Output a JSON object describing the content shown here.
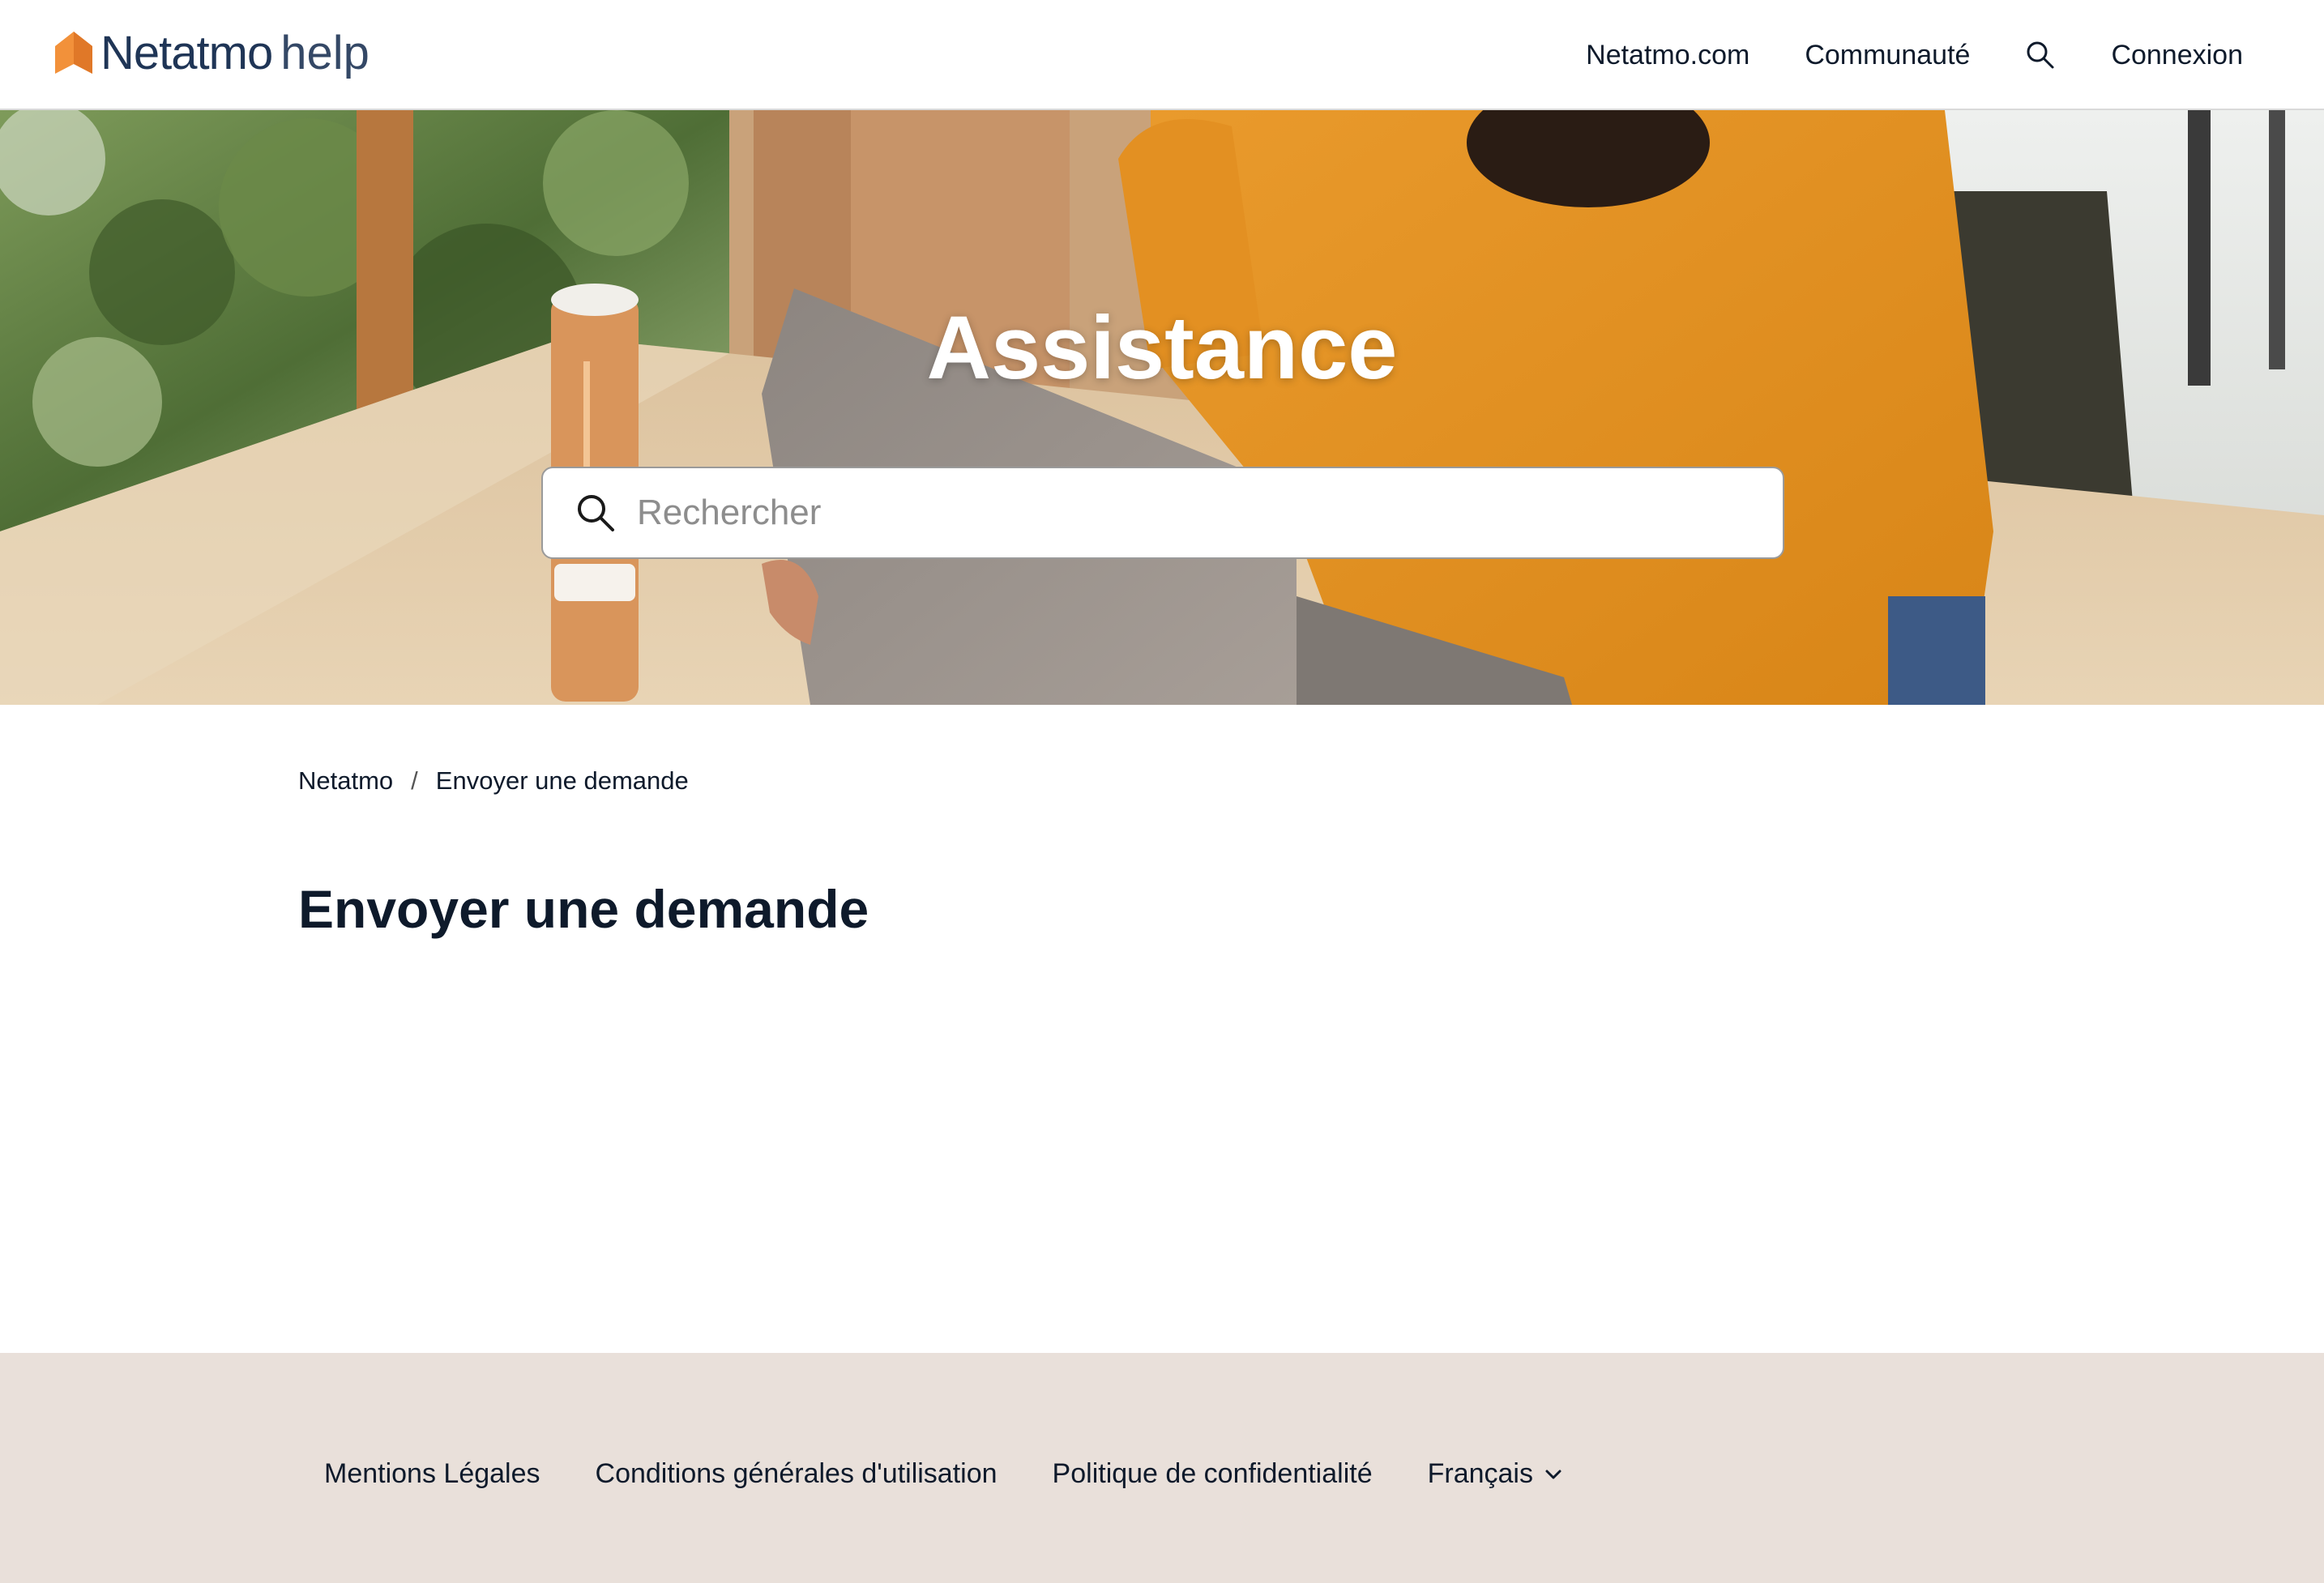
{
  "header": {
    "logo_brand": "Netatmo",
    "logo_suffix": "help",
    "nav": [
      {
        "label": "Netatmo.com"
      },
      {
        "label": "Communauté"
      },
      {
        "label": "Connexion"
      }
    ],
    "search_icon": "search-icon"
  },
  "hero": {
    "title": "Assistance",
    "search_placeholder": "Rechercher",
    "search_icon": "search-icon"
  },
  "breadcrumb": {
    "items": [
      "Netatmo",
      "Envoyer une demande"
    ],
    "separator": "/"
  },
  "main": {
    "title": "Envoyer une demande"
  },
  "footer": {
    "links": [
      {
        "label": "Mentions Légales"
      },
      {
        "label": "Conditions générales d'utilisation"
      },
      {
        "label": "Politique de confidentialité"
      }
    ],
    "language": "Français",
    "language_icon": "chevron-down-icon"
  },
  "colors": {
    "brand_orange": "#f2913a",
    "brand_navy": "#1f3556",
    "footer_bg": "#e9e0da"
  }
}
